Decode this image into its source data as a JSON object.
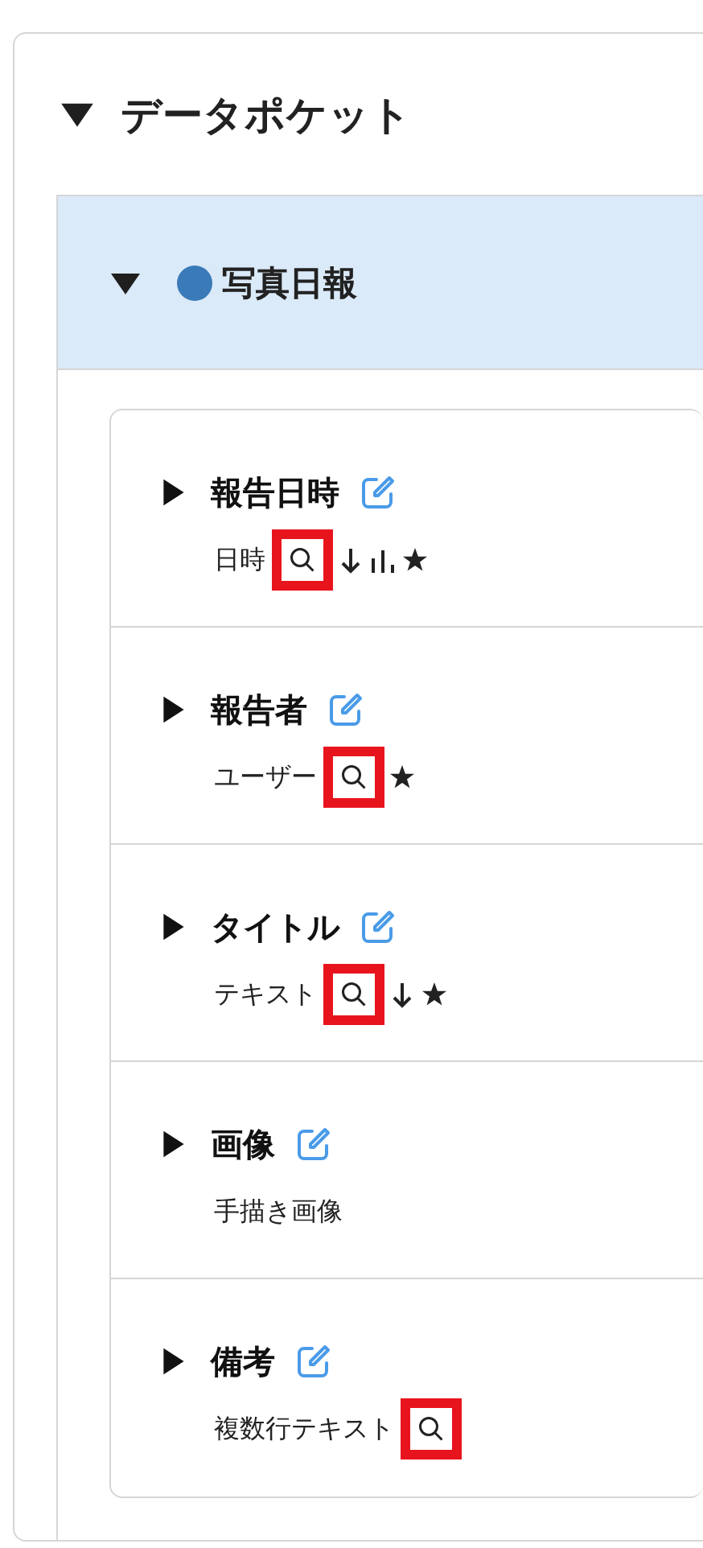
{
  "section": {
    "title": "データポケット",
    "expanded": true
  },
  "group": {
    "title": "写真日報",
    "expanded": true,
    "color": "#3a7ab8",
    "fields": [
      {
        "name": "報告日時",
        "expanded": false,
        "type": "日時",
        "icons": [
          {
            "kind": "search",
            "highlighted": true
          },
          {
            "kind": "sort"
          },
          {
            "kind": "chart"
          },
          {
            "kind": "star"
          }
        ]
      },
      {
        "name": "報告者",
        "expanded": false,
        "type": "ユーザー",
        "icons": [
          {
            "kind": "search",
            "highlighted": true
          },
          {
            "kind": "star"
          }
        ]
      },
      {
        "name": "タイトル",
        "expanded": false,
        "type": "テキスト",
        "icons": [
          {
            "kind": "search",
            "highlighted": true
          },
          {
            "kind": "sort"
          },
          {
            "kind": "star"
          }
        ]
      },
      {
        "name": "画像",
        "expanded": false,
        "type": "手描き画像"
      },
      {
        "name": "備考",
        "expanded": false,
        "type": "複数行テキスト",
        "icons": [
          {
            "kind": "search",
            "highlighted": true
          }
        ]
      }
    ]
  }
}
